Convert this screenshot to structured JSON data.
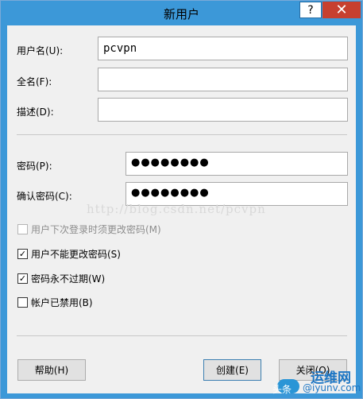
{
  "window": {
    "title": "新用户",
    "help_glyph": "?",
    "close_glyph": "✕"
  },
  "form": {
    "username_label": "用户名(U):",
    "username_value": "pcvpn",
    "fullname_label": "全名(F):",
    "fullname_value": "",
    "description_label": "描述(D):",
    "description_value": "",
    "password_label": "密码(P):",
    "password_value": "●●●●●●●●",
    "confirm_label": "确认密码(C):",
    "confirm_value": "●●●●●●●●"
  },
  "watermark": "http://blog.csdn.net/pcvpn",
  "options": [
    {
      "label": "用户下次登录时须更改密码(M)",
      "checked": false,
      "enabled": false
    },
    {
      "label": "用户不能更改密码(S)",
      "checked": true,
      "enabled": true
    },
    {
      "label": "密码永不过期(W)",
      "checked": true,
      "enabled": true
    },
    {
      "label": "帐户已禁用(B)",
      "checked": false,
      "enabled": true
    }
  ],
  "buttons": {
    "help": "帮助(H)",
    "create": "创建(E)",
    "close": "关闭(O)"
  },
  "corner_logo": {
    "caption": "头条",
    "brand": "运维网",
    "url": "@iyunv.com"
  },
  "colors": {
    "titlebar": "#3c98d8",
    "close_button": "#c7402f",
    "client_bg": "#f0f0f0"
  }
}
